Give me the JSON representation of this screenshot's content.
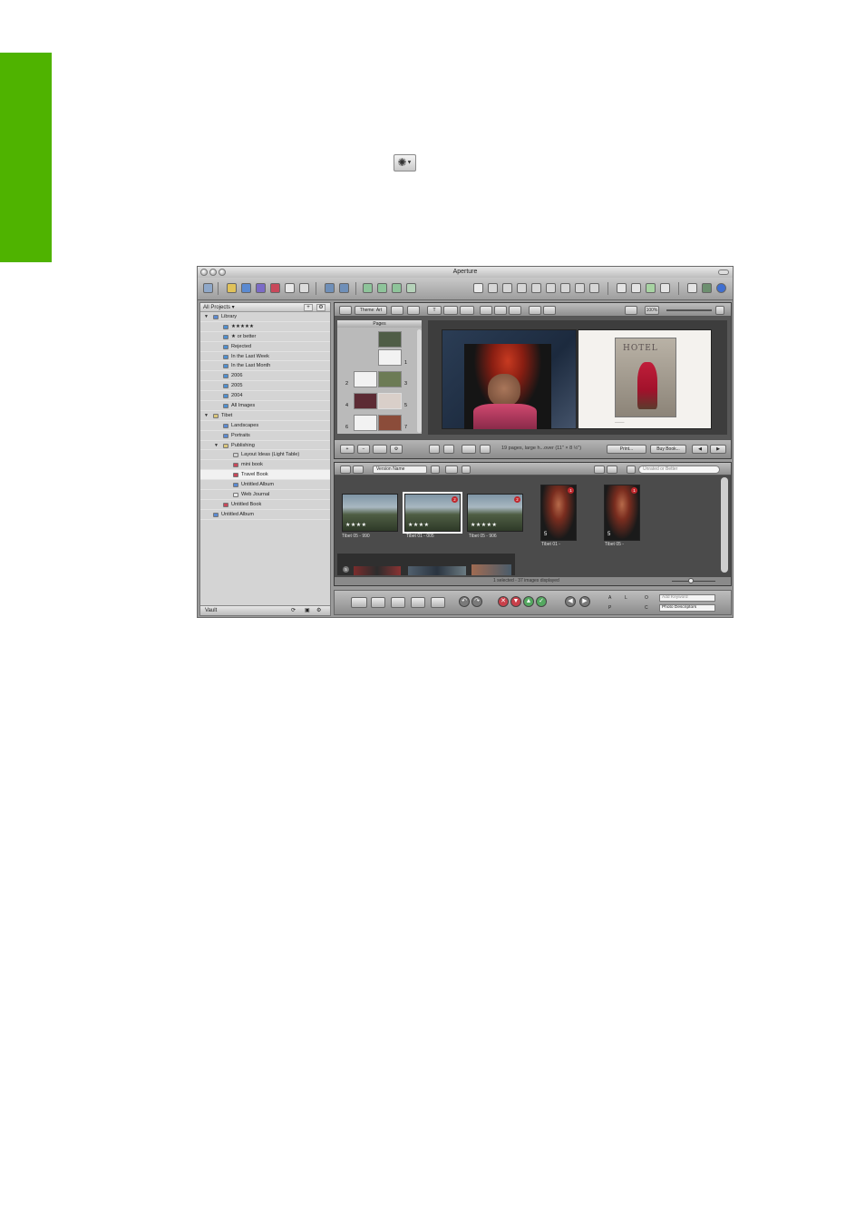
{
  "page": {
    "inline_icon": "gear-action-icon"
  },
  "window": {
    "title": "Aperture"
  },
  "projects_panel": {
    "header": "All Projects",
    "add_btn": "+",
    "gear_btn": "⚙",
    "items": [
      {
        "label": "Library",
        "indent": 0,
        "expander": "▼",
        "icon": "library-icon",
        "color": "#5b8ad1"
      },
      {
        "label": "★★★★★",
        "indent": 1,
        "icon": "smart-album-icon",
        "color": "#4f8fd0"
      },
      {
        "label": "★ or better",
        "indent": 1,
        "icon": "smart-album-icon",
        "color": "#4f8fd0"
      },
      {
        "label": "Rejected",
        "indent": 1,
        "icon": "smart-album-icon",
        "color": "#4f8fd0"
      },
      {
        "label": "In the Last Week",
        "indent": 1,
        "icon": "smart-album-icon",
        "color": "#4f8fd0"
      },
      {
        "label": "In the Last Month",
        "indent": 1,
        "icon": "smart-album-icon",
        "color": "#4f8fd0"
      },
      {
        "label": "2006",
        "indent": 1,
        "icon": "smart-album-icon",
        "color": "#4f8fd0"
      },
      {
        "label": "2005",
        "indent": 1,
        "icon": "smart-album-icon",
        "color": "#4f8fd0"
      },
      {
        "label": "2004",
        "indent": 1,
        "icon": "smart-album-icon",
        "color": "#4f8fd0"
      },
      {
        "label": "All Images",
        "indent": 1,
        "icon": "smart-album-icon",
        "color": "#4f8fd0"
      },
      {
        "label": "Tibet",
        "indent": 0,
        "expander": "▼",
        "icon": "folder-icon",
        "color": "#d9c57a"
      },
      {
        "label": "Landscapes",
        "indent": 1,
        "icon": "project-icon",
        "color": "#5b8ad1"
      },
      {
        "label": "Portraits",
        "indent": 1,
        "icon": "project-icon",
        "color": "#5b8ad1"
      },
      {
        "label": "Publishing",
        "indent": 1,
        "expander": "▼",
        "icon": "folder-icon",
        "color": "#d9c57a"
      },
      {
        "label": "Layout Ideas (Light Table)",
        "indent": 2,
        "icon": "light-table-icon",
        "color": "#cfcfcf"
      },
      {
        "label": "mini book",
        "indent": 2,
        "icon": "book-icon",
        "color": "#c8485a"
      },
      {
        "label": "Travel Book",
        "indent": 2,
        "icon": "book-icon",
        "color": "#c8485a",
        "selected": true
      },
      {
        "label": "Untitled Album",
        "indent": 2,
        "icon": "album-icon",
        "color": "#5b8ad1"
      },
      {
        "label": "Web Journal",
        "indent": 2,
        "icon": "web-journal-icon",
        "color": "#e6e6e6"
      },
      {
        "label": "Untitled Book",
        "indent": 1,
        "icon": "book-icon",
        "color": "#c8485a"
      },
      {
        "label": "Untitled Album",
        "indent": 0,
        "icon": "album-icon",
        "color": "#5b8ad1"
      }
    ],
    "vault_label": "Vault"
  },
  "book": {
    "theme_label": "Theme: Art",
    "pages_label": "Pages",
    "page_numbers": [
      "1",
      "2",
      "3",
      "4",
      "5",
      "6",
      "7"
    ],
    "zoom_label": "100%",
    "wall_text": "HOTEL",
    "info_text": "19 pages, large h...over (11\" × 8 ½\")",
    "print_label": "Print...",
    "buy_label": "Buy Book..."
  },
  "browser": {
    "sort_select": "Version Name",
    "filter_placeholder": "Unrated or Better",
    "images": [
      {
        "label": "Tibet 05 - 990",
        "stars": "★★★★",
        "kind": "landscape"
      },
      {
        "label": "Tibet 01 - 005",
        "stars": "★★★★",
        "kind": "landscape",
        "badge": "2",
        "selected": true
      },
      {
        "label": "Tibet 05 - 906",
        "stars": "★★★★★",
        "kind": "landscape",
        "badge": "2"
      },
      {
        "label": "Tibet 01 -",
        "stars": "5",
        "kind": "portrait",
        "badge": "1"
      },
      {
        "label": "Tibet 05 -",
        "stars": "5",
        "kind": "portrait",
        "badge": "1"
      }
    ],
    "filmstrip_badge": "5",
    "status": "1 selected - 37 images displayed"
  },
  "controls": {
    "keyword_placeholder": "Add Keyword",
    "preset_select": "Photo Descriptors",
    "key_labels": [
      "A",
      "L",
      "O",
      "P",
      "C"
    ]
  }
}
